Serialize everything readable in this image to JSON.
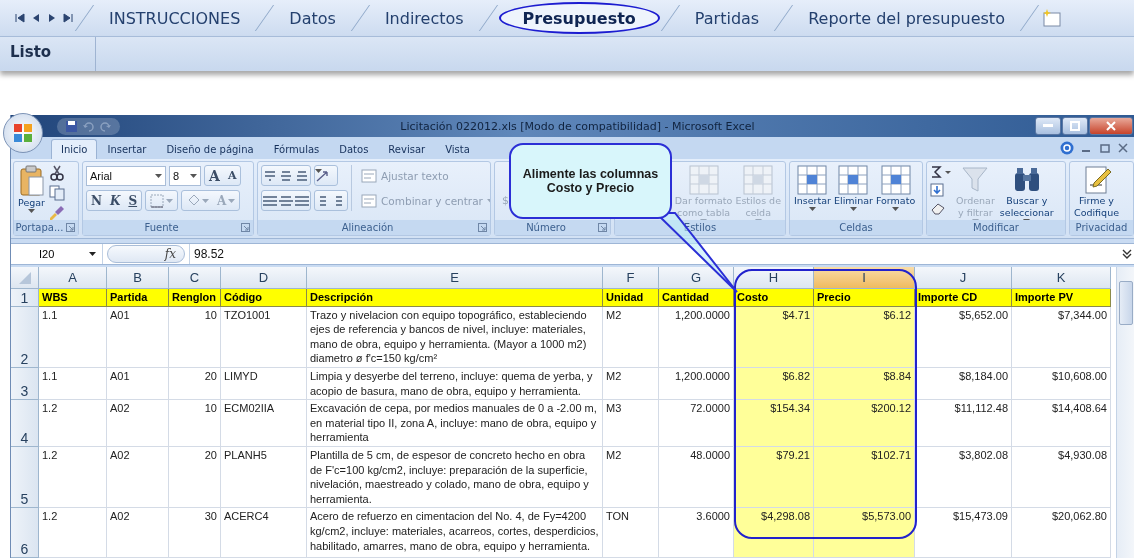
{
  "sheet_tabs": [
    {
      "label": "INSTRUCCIONES",
      "selected": false
    },
    {
      "label": "Datos",
      "selected": false
    },
    {
      "label": "Indirectos",
      "selected": false
    },
    {
      "label": "Presupuesto",
      "selected": true
    },
    {
      "label": "Partidas",
      "selected": false
    },
    {
      "label": "Reporte del presupuesto",
      "selected": false
    }
  ],
  "status_bar": {
    "text": "Listo"
  },
  "window": {
    "title": "Licitación 022012.xls [Modo de compatibilidad] - Microsoft Excel"
  },
  "ribbon_tabs": [
    {
      "label": "Inicio",
      "selected": true
    },
    {
      "label": "Insertar",
      "selected": false
    },
    {
      "label": "Diseño de página",
      "selected": false
    },
    {
      "label": "Fórmulas",
      "selected": false
    },
    {
      "label": "Datos",
      "selected": false
    },
    {
      "label": "Revisar",
      "selected": false
    },
    {
      "label": "Vista",
      "selected": false
    }
  ],
  "ribbon_groups": [
    {
      "kind": "clipboard",
      "label": "Portapa...",
      "launcher": true,
      "paste_label": "Pegar"
    },
    {
      "kind": "font",
      "label": "Fuente",
      "launcher": true,
      "font": "Arial",
      "size": "8",
      "size_buttons": [
        "A",
        "A"
      ],
      "style_buttons": [
        "N",
        "K",
        "S"
      ],
      "color_button": "A"
    },
    {
      "kind": "alignment",
      "label": "Alineación",
      "launcher": true,
      "buttons": [
        {
          "label": "Ajustar texto",
          "disabled": true
        },
        {
          "label": "Combinar y centrar",
          "disabled": true
        }
      ]
    },
    {
      "kind": "number",
      "label": "Número",
      "launcher": true,
      "buttons": [
        "$"
      ]
    },
    {
      "kind": "styles",
      "label": "Estilos",
      "launcher": false,
      "buttons": [
        {
          "label": "Dar formato\ncomo tabla",
          "disabled": true
        },
        {
          "label": "Estilos de\ncelda",
          "disabled": true
        }
      ]
    },
    {
      "kind": "cells",
      "label": "Celdas",
      "launcher": false,
      "buttons": [
        {
          "label": "Insertar",
          "disabled": false
        },
        {
          "label": "Eliminar",
          "disabled": false
        },
        {
          "label": "Formato",
          "disabled": false
        }
      ]
    },
    {
      "kind": "editing",
      "label": "Modificar",
      "launcher": false,
      "buttons": [
        {
          "label": "Ordenar\ny filtrar",
          "disabled": true
        },
        {
          "label": "Buscar y\nseleccionar",
          "disabled": false
        }
      ]
    },
    {
      "kind": "privacy",
      "label": "Privacidad",
      "launcher": false,
      "buttons": [
        {
          "label": "Firme y\nCodifique",
          "disabled": false
        }
      ]
    }
  ],
  "formula_bar": {
    "name_box": "I20",
    "fx_label": "fx",
    "value": "98.52"
  },
  "sheet": {
    "columns": [
      {
        "letter": "A",
        "numeric": false,
        "selected": false,
        "highlighted": false
      },
      {
        "letter": "B",
        "numeric": false,
        "selected": false,
        "highlighted": false
      },
      {
        "letter": "C",
        "numeric": true,
        "selected": false,
        "highlighted": false
      },
      {
        "letter": "D",
        "numeric": false,
        "selected": false,
        "highlighted": false
      },
      {
        "letter": "E",
        "numeric": false,
        "selected": false,
        "highlighted": false
      },
      {
        "letter": "F",
        "numeric": false,
        "selected": false,
        "highlighted": false
      },
      {
        "letter": "G",
        "numeric": true,
        "selected": false,
        "highlighted": false
      },
      {
        "letter": "H",
        "numeric": true,
        "selected": false,
        "highlighted": true
      },
      {
        "letter": "I",
        "numeric": true,
        "selected": true,
        "highlighted": true
      },
      {
        "letter": "J",
        "numeric": true,
        "selected": false,
        "highlighted": false
      },
      {
        "letter": "K",
        "numeric": true,
        "selected": false,
        "highlighted": false
      }
    ],
    "rows": [
      {
        "number": "1",
        "kind": "header",
        "cells": [
          "WBS",
          "Partida",
          "Renglon",
          "Código",
          "Descripción",
          "Unidad",
          "Cantidad",
          "Costo",
          "Precio",
          "Importe CD",
          "Importe PV"
        ]
      },
      {
        "number": "2",
        "kind": "data",
        "cells": [
          "1.1",
          "A01",
          "10",
          "TZO1001",
          "Trazo y nivelacion con equipo topográfico, estableciendo ejes de referencia y bancos de nivel, incluye: materiales, mano de obra, equipo y herramienta. (Mayor a 1000  m2) diametro ø  f'c=150 kg/cm²",
          "M2",
          "1,200.0000",
          "$4.71",
          "$6.12",
          "$5,652.00",
          "$7,344.00"
        ]
      },
      {
        "number": "3",
        "kind": "data",
        "cells": [
          "1.1",
          "A01",
          "20",
          "LIMYD",
          "Limpia y desyerbe del terreno, incluye: quema de yerba, y acopio de basura, mano de obra, equipo y herramienta.",
          "M2",
          "1,200.0000",
          "$6.82",
          "$8.84",
          "$8,184.00",
          "$10,608.00"
        ]
      },
      {
        "number": "4",
        "kind": "data",
        "cells": [
          "1.2",
          "A02",
          "10",
          "ECM02IIA",
          "Excavación de cepa, por medios manuales de 0 a -2.00 m, en material tipo II,  zona A, incluye: mano de obra, equipo y herramienta",
          "M3",
          "72.0000",
          "$154.34",
          "$200.12",
          "$11,112.48",
          "$14,408.64"
        ]
      },
      {
        "number": "5",
        "kind": "data",
        "cells": [
          "1.2",
          "A02",
          "20",
          "PLANH5",
          "Plantilla de 5 cm, de espesor de concreto hecho en obra de F'c=100 kg/cm2, incluye: preparación de la superficie, nivelación, maestreado y colado, mano de obra, equipo y herramienta.",
          "M2",
          "48.0000",
          "$79.21",
          "$102.71",
          "$3,802.08",
          "$4,930.08"
        ]
      },
      {
        "number": "6",
        "kind": "data",
        "cells": [
          "1.2",
          "A02",
          "30",
          "ACERC4",
          "Acero de refuerzo en cimentacion del No. 4, de  Fy=4200 kg/cm2, incluye: materiales, acarreos, cortes, desperdicios, habilitado, amarres, mano de obra, equipo y herramienta.",
          "TON",
          "3.6000",
          "$4,298.08",
          "$5,573.00",
          "$15,473.09",
          "$20,062.80"
        ]
      }
    ]
  },
  "callout": {
    "text": "Alimente las columnas Costo y Precio"
  }
}
